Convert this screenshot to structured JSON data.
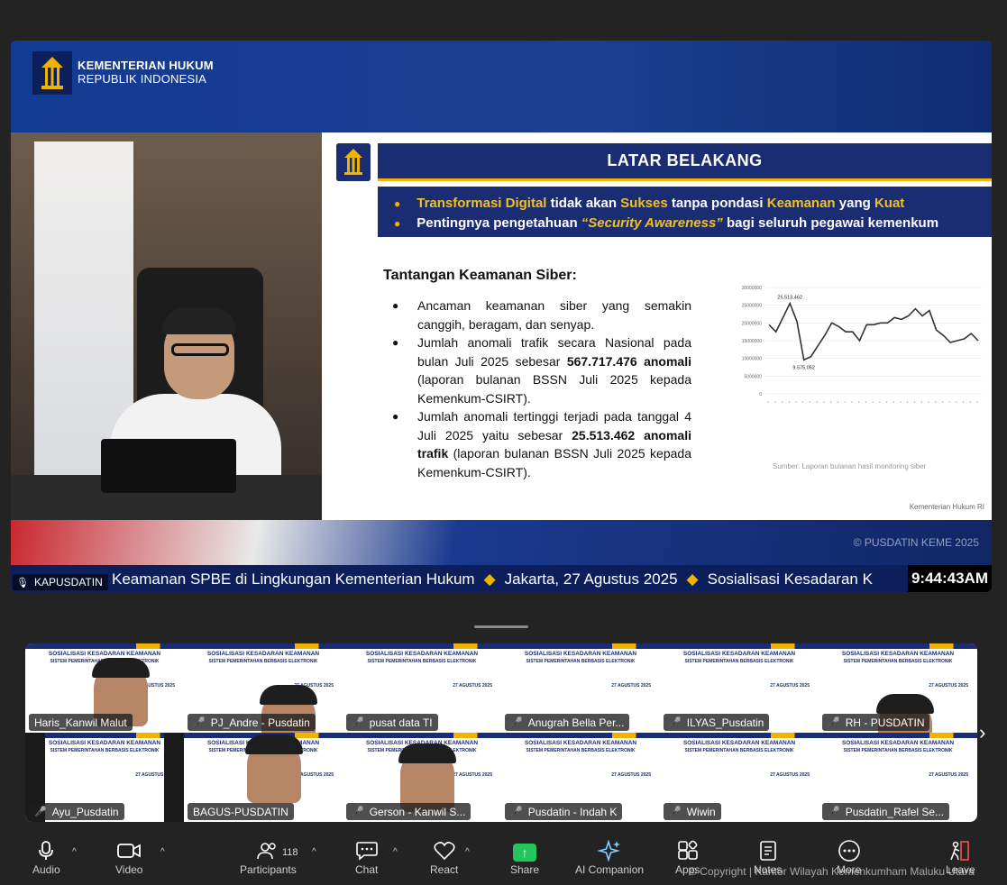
{
  "main_video": {
    "ministry_line1": "KEMENTERIAN HUKUM",
    "ministry_line2": "REPUBLIK INDONESIA",
    "slide_title": "LATAR BELAKANG",
    "bullet1_a": "Transformasi Digital",
    "bullet1_b": " tidak akan ",
    "bullet1_c": "Sukses",
    "bullet1_d": " tanpa pondasi ",
    "bullet1_e": "Keamanan",
    "bullet1_f": " yang ",
    "bullet1_g": "Kuat",
    "bullet2_a": "Pentingnya pengetahuan ",
    "bullet2_b": "“Security Awareness”",
    "bullet2_c": " bagi seluruh pegawai kemenkum",
    "subtitle": "Tantangan Keamanan Siber:",
    "point1": "Ancaman keamanan siber yang semakin canggih, beragam, dan senyap.",
    "point2_a": "Jumlah anomali trafik secara Nasional pada bulan Juli 2025 sebesar ",
    "point2_b": "567.717.476 anomali",
    "point2_c": " (laporan bulanan BSSN Juli 2025 kepada Kemenkum-CSIRT).",
    "point3_a": "Jumlah anomali tertinggi terjadi pada tanggal 4 Juli 2025 yaitu sebesar ",
    "point3_b": "25.513.462 anomali trafik",
    "point3_c": " (laporan bulanan BSSN Juli 2025 kepada Kemenkum-CSIRT).",
    "chart_source": "Sumber: Laporan bulanan hasil monitoring siber",
    "slide_footer": "Kementerian Hukum RI",
    "watermark": "© PUSDATIN KEME",
    "watermark_year": "2025",
    "ticker_a": "Keamanan SPBE di Lingkungan Kementerian Hukum",
    "ticker_b": "Jakarta, 27 Agustus 2025",
    "ticker_c": "Sosialisasi Kesadaran K",
    "clock": "9:44:43AM",
    "speaker_name": "KAPUSDATIN"
  },
  "chart_data": {
    "type": "line",
    "y_ticks": [
      "30000000",
      "25000000",
      "20000000",
      "15000000",
      "10000000",
      "5000000",
      "0"
    ],
    "ylim": [
      0,
      30000000
    ],
    "values": [
      19500000,
      17500000,
      21500000,
      25513462,
      20500000,
      9575052,
      10500000,
      13500000,
      16500000,
      20000000,
      19000000,
      17500000,
      17500000,
      15000000,
      19500000,
      19500000,
      20000000,
      20000000,
      21500000,
      21000000,
      22000000,
      24000000,
      22000000,
      23500000,
      18000000,
      16500000,
      14500000,
      15000000,
      15500000,
      17000000,
      15000000
    ],
    "annotations": [
      "25.513.462",
      "9.575.052"
    ]
  },
  "gallery": {
    "slide_head_1": "SOSIALISASI KESADARAN KEAMANAN",
    "slide_head_2": "SISTEM PEMERINTAHAN BERBASIS ELEKTRONIK",
    "slide_date": "27 AGUSTUS 2025",
    "participants": [
      {
        "name": "Haris_Kanwil Malut",
        "muted": false
      },
      {
        "name": "PJ_Andre - Pusdatin",
        "muted": true
      },
      {
        "name": "pusat data TI",
        "muted": true
      },
      {
        "name": "Anugrah Bella Per...",
        "muted": true
      },
      {
        "name": "ILYAS_Pusdatin",
        "muted": true
      },
      {
        "name": "RH - PUSDATIN",
        "muted": true
      },
      {
        "name": "Ayu_Pusdatin",
        "muted": true
      },
      {
        "name": "BAGUS-PUSDATIN",
        "muted": false
      },
      {
        "name": "Gerson - Kanwil S...",
        "muted": true
      },
      {
        "name": "Pusdatin - Indah K",
        "muted": true
      },
      {
        "name": "Wiwin",
        "muted": true
      },
      {
        "name": "Pusdatin_Rafel Se...",
        "muted": true
      }
    ]
  },
  "toolbar": {
    "audio": "Audio",
    "video": "Video",
    "participants": "Participants",
    "participants_count": "118",
    "chat": "Chat",
    "react": "React",
    "share": "Share",
    "ai_companion": "AI Companion",
    "apps": "Apps",
    "notes": "Notes",
    "more": "More",
    "leave": "Leave"
  },
  "copyright": "© Copyright | Kantor Wilayah Kemenkumham Maluku Utara",
  "colors": {
    "accent_green": "#22c55e",
    "slide_navy": "#1b2d72",
    "slide_gold": "#f0b400",
    "muted_red": "#e5484d"
  }
}
